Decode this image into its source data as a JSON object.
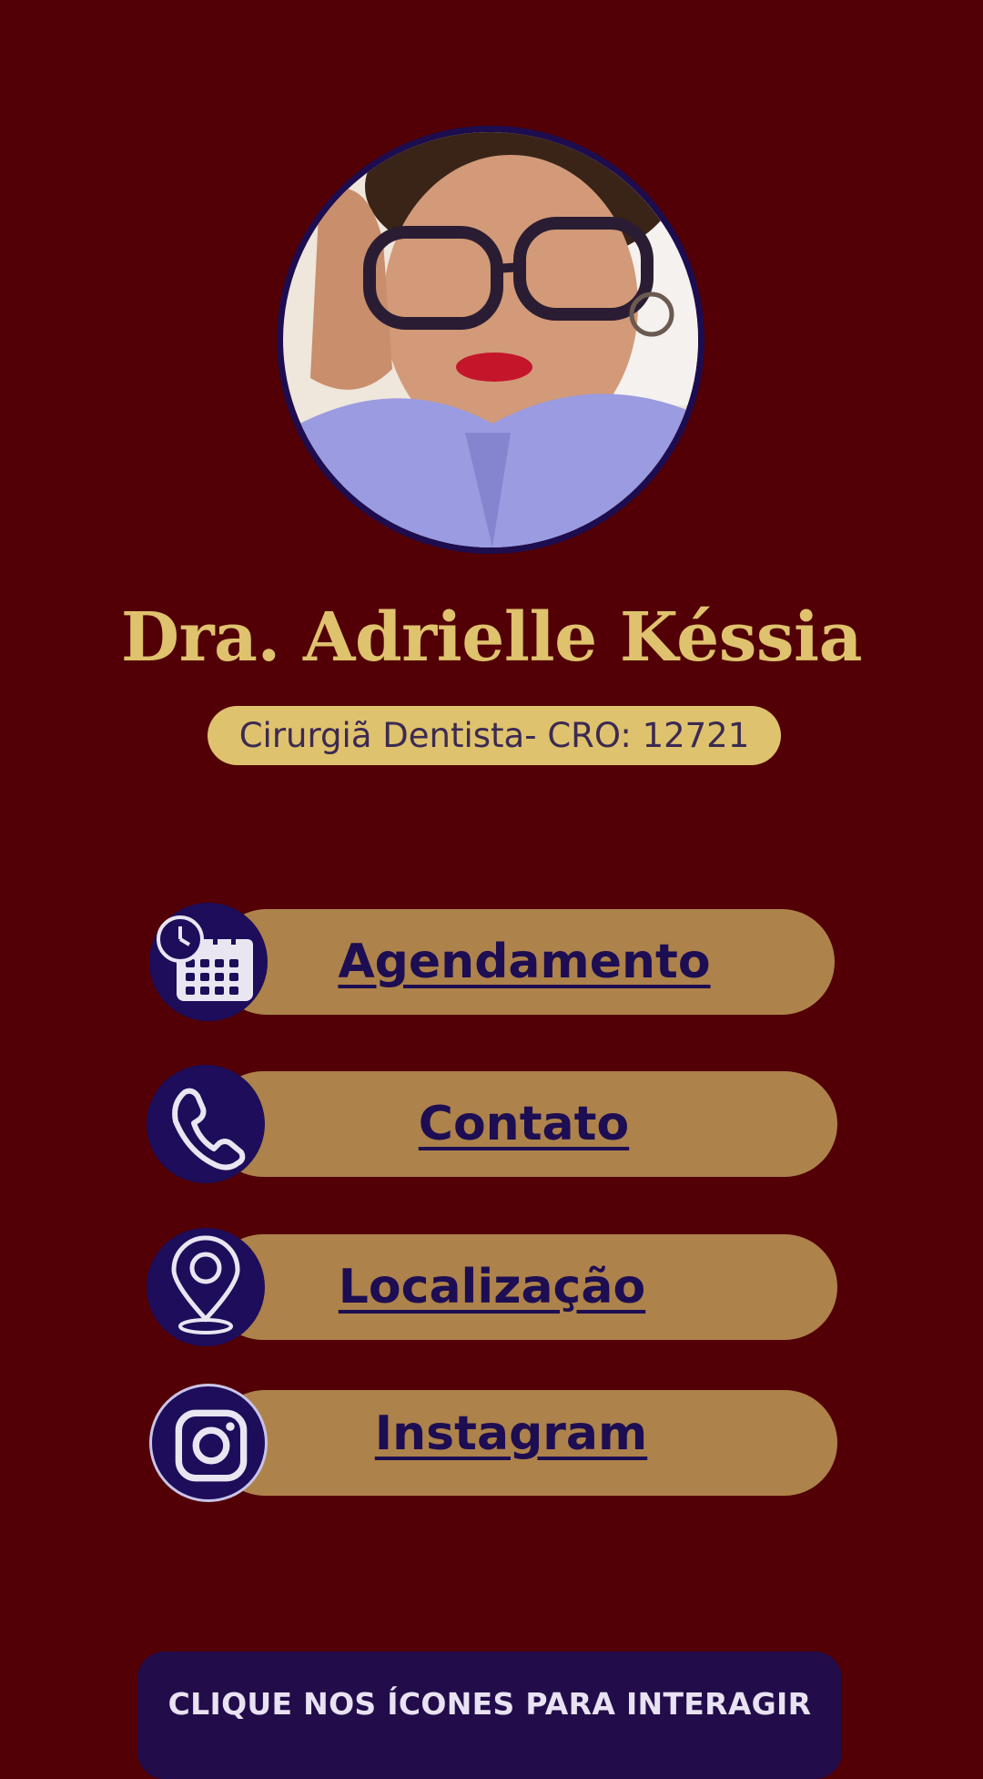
{
  "profile": {
    "name": "Dra. Adrielle Késsia",
    "subtitle": "Cirurgiã Dentista- CRO: 12721"
  },
  "links": [
    {
      "label": "Agendamento",
      "icon": "calendar-clock-icon"
    },
    {
      "label": "Contato",
      "icon": "phone-icon"
    },
    {
      "label": "Localização",
      "icon": "map-pin-icon"
    },
    {
      "label": "Instagram",
      "icon": "instagram-icon"
    }
  ],
  "footer": {
    "cta": "CLIQUE NOS ÍCONES PARA INTERAGIR"
  },
  "colors": {
    "background": "#520006",
    "gold": "#dfc26d",
    "pill": "#ad824b",
    "navy": "#1d0d52"
  }
}
